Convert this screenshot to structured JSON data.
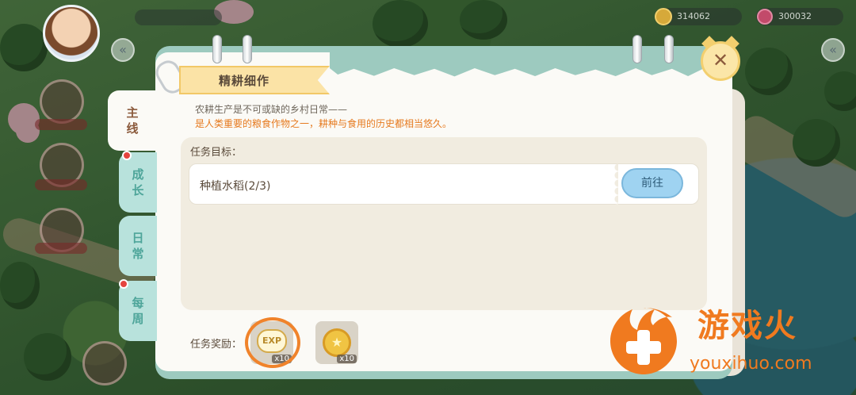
{
  "hud": {
    "coins": "314062",
    "gems": "300032"
  },
  "dialog": {
    "title": "精耕细作",
    "description_line1": "农耕生产是不可或缺的乡村日常——",
    "description_line2": "是人类重要的粮食作物之一，耕种与食用的历史都相当悠久。",
    "close_label": "✕"
  },
  "tabs": [
    {
      "label": "主线",
      "active": true,
      "has_dot": false
    },
    {
      "label": "成长",
      "active": false,
      "has_dot": true
    },
    {
      "label": "日常",
      "active": false,
      "has_dot": false
    },
    {
      "label": "每周",
      "active": false,
      "has_dot": true
    }
  ],
  "goal": {
    "title": "任务目标：",
    "task_text": "种植水稻(2/3)",
    "go_button": "前往"
  },
  "rewards": {
    "label": "任务奖励：",
    "items": [
      {
        "icon": "exp-icon",
        "icon_text": "EXP",
        "count": "x10"
      },
      {
        "icon": "coin-icon",
        "icon_text": "★",
        "count": "x10"
      }
    ]
  },
  "watermark": {
    "brand": "游戏火",
    "url": "youxihuo.com"
  },
  "colors": {
    "panel_border": "#9dcabf",
    "go_button": "#9fd3f1",
    "description_highlight": "#e67a1f",
    "watermark": "#f07a1f"
  }
}
